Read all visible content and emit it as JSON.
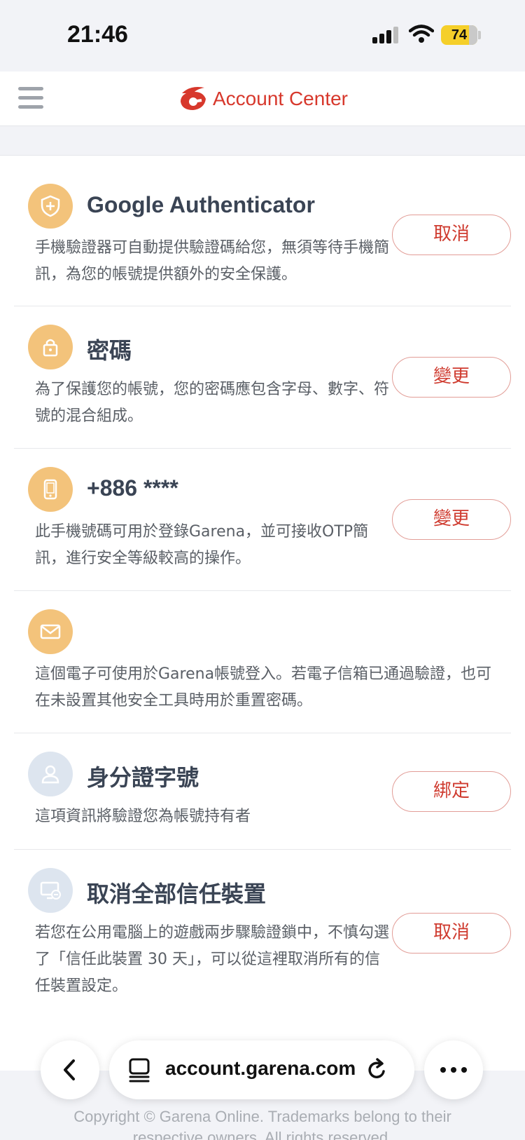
{
  "status_bar": {
    "time": "21:46",
    "battery": "74",
    "battery_color": "#f5cf2a"
  },
  "header": {
    "menu_icon": "hamburger-icon",
    "logo_icon": "garena-logo",
    "title": "Account Center",
    "brand_color": "#d7382c"
  },
  "items": [
    {
      "icon": "shield-icon",
      "title": "Google Authenticator",
      "desc": "手機驗證器可自動提供驗證碼給您，無須等待手機簡訊，為您的帳號提供額外的安全保護。",
      "button": "取消"
    },
    {
      "icon": "lock-icon",
      "title": "密碼",
      "desc": "為了保護您的帳號，您的密碼應包含字母、數字、符號的混合組成。",
      "button": "變更"
    },
    {
      "icon": "phone-icon",
      "title": "+886 ****",
      "desc": "此手機號碼可用於登錄Garena，並可接收OTP簡訊，進行安全等級較高的操作。",
      "button": "變更"
    },
    {
      "icon": "mail-icon",
      "title": "",
      "desc": "這個電子可使用於Garena帳號登入。若電子信箱已通過驗證，也可在未設置其他安全工具時用於重置密碼。",
      "button": ""
    },
    {
      "icon": "id-card-icon",
      "title": "身分證字號",
      "desc": "這項資訊將驗證您為帳號持有者",
      "button": "綁定"
    },
    {
      "icon": "monitor-remove-icon",
      "title": "取消全部信任裝置",
      "desc": "若您在公用電腦上的遊戲兩步驟驗證鎖中，不慎勾選了「信任此裝置 30 天」，可以從這裡取消所有的信任裝置設定。",
      "button": "取消"
    }
  ],
  "browser": {
    "url": "account.garena.com",
    "back_icon": "chevron-left-icon",
    "tabs_icon": "page-icon",
    "reload_icon": "reload-icon",
    "more_icon": "more-icon"
  },
  "footer": {
    "line1": "Copyright © Garena Online. Trademarks belong to their",
    "line2": "respective owners. All rights reserved."
  }
}
